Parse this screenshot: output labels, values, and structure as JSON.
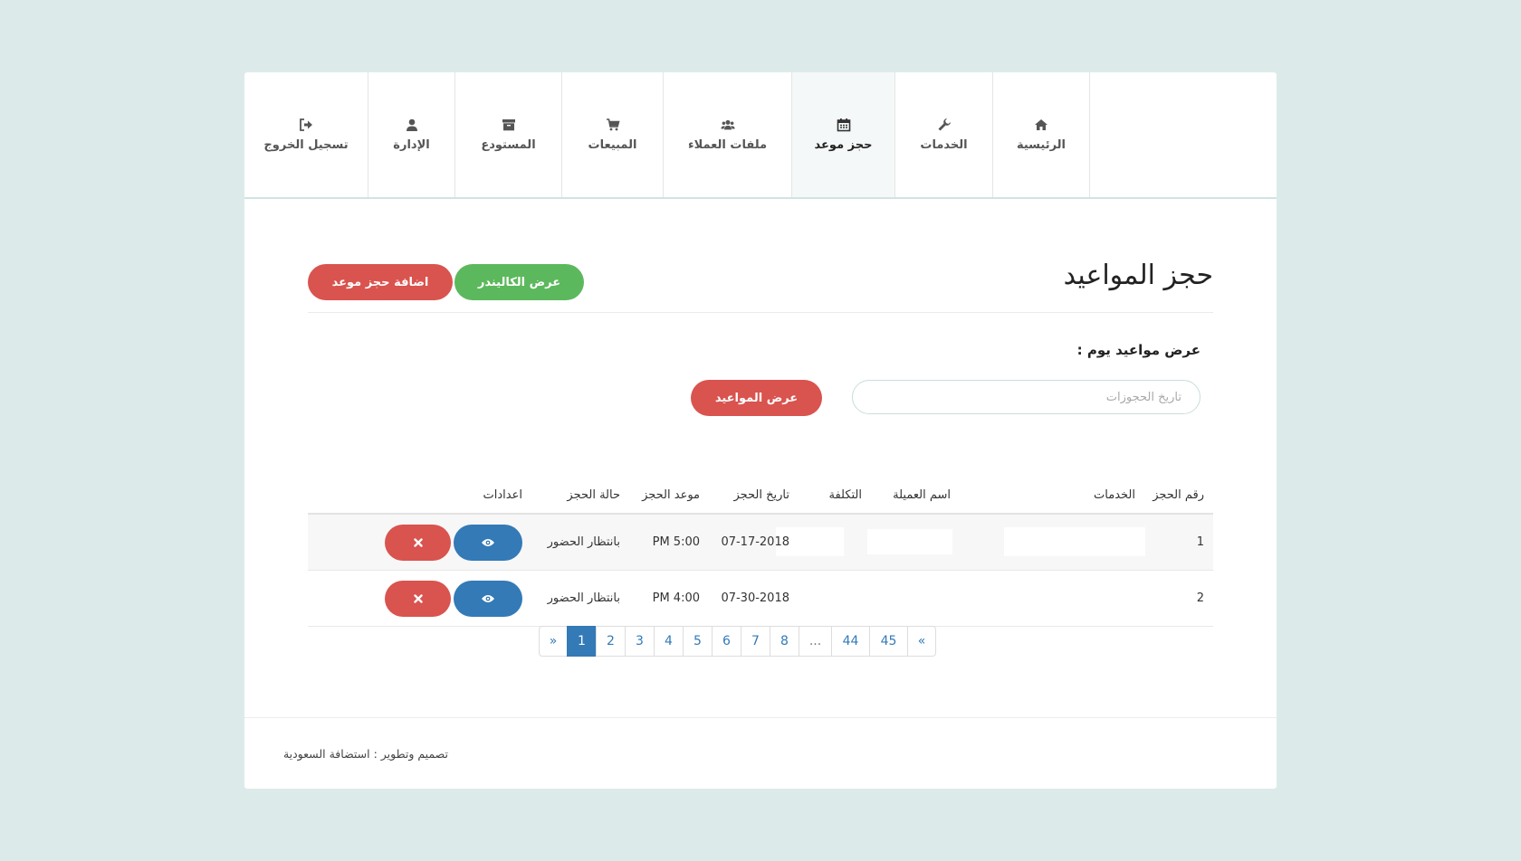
{
  "nav": {
    "items": [
      {
        "label": "الرئيسية",
        "icon": "home-icon",
        "active": false
      },
      {
        "label": "الخدمات",
        "icon": "wrench-icon",
        "active": false
      },
      {
        "label": "حجز موعد",
        "icon": "calendar-icon",
        "active": true
      },
      {
        "label": "ملفات العملاء",
        "icon": "users-icon",
        "active": false
      },
      {
        "label": "المبيعات",
        "icon": "cart-icon",
        "active": false
      },
      {
        "label": "المستودع",
        "icon": "archive-icon",
        "active": false
      },
      {
        "label": "الإدارة",
        "icon": "user-icon",
        "active": false
      },
      {
        "label": "تسجيل الخروج",
        "icon": "logout-icon",
        "active": false
      }
    ]
  },
  "page": {
    "title": "حجز المواعيد",
    "view_calendar_label": "عرض الكاليندر",
    "add_booking_label": "اضافة حجز موعد"
  },
  "filter": {
    "label": "عرض مواعيد يوم :",
    "date_value": "",
    "date_placeholder": "تاريخ الحجوزات",
    "submit_label": "عرض المواعيد"
  },
  "table": {
    "headers": {
      "number": "رقم الحجز",
      "services": "الخدمات",
      "client": "اسم العميلة",
      "cost": "التكلفة",
      "date": "تاريخ الحجز",
      "time": "موعد الحجز",
      "status": "حالة الحجز",
      "actions": "اعدادات"
    },
    "rows": [
      {
        "number": "1",
        "services": "",
        "client": "",
        "cost": "",
        "date": "07-17-2018",
        "time": "PM 5:00",
        "status": "بانتظار الحضور"
      },
      {
        "number": "2",
        "services": "",
        "client": "",
        "cost": "",
        "date": "07-30-2018",
        "time": "PM 4:00",
        "status": "بانتظار الحضور"
      }
    ]
  },
  "pagination": {
    "prev": "»",
    "pages": [
      "1",
      "2",
      "3",
      "4",
      "5",
      "6",
      "7",
      "8",
      "...",
      "44",
      "45"
    ],
    "next": "«",
    "current": "1"
  },
  "footer": {
    "text": "تصميم وتطوير : استضافة السعودية"
  },
  "colors": {
    "background": "#dcebea",
    "red": "#d9534f",
    "green": "#5cb85c",
    "blue": "#337ab7"
  }
}
